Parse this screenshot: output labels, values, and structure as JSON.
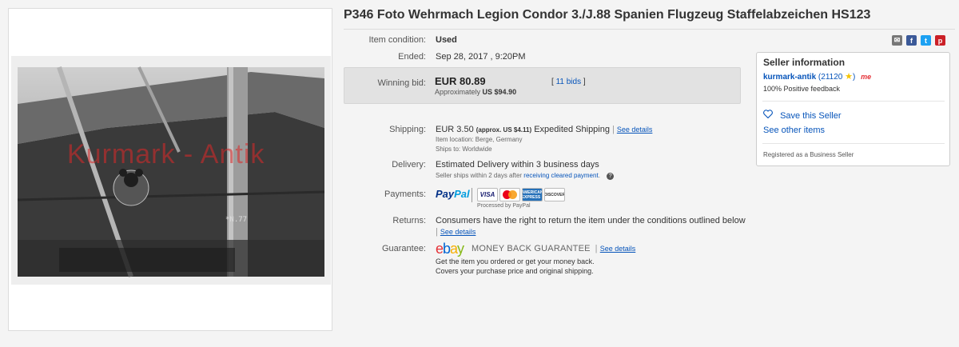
{
  "photo": {
    "watermark": "Kurmark - Antik",
    "plane_marking": "*N.77"
  },
  "title": "P346 Foto Wehrmach Legion Condor 3./J.88 Spanien Flugzeug Staffelabzeichen HS123",
  "share_icons": [
    "email-icon",
    "facebook-icon",
    "twitter-icon",
    "pinterest-icon"
  ],
  "condition": {
    "label": "Item condition:",
    "value": "Used"
  },
  "ended": {
    "label": "Ended:",
    "value": "Sep 28, 2017 , 9:20PM"
  },
  "bid": {
    "label": "Winning bid:",
    "amount": "EUR 80.89",
    "approx_prefix": "Approximately",
    "approx_value": "US $94.90",
    "bids_link": "11 bids",
    "bids_open": "[",
    "bids_close": "]"
  },
  "shipping": {
    "label": "Shipping:",
    "amount": "EUR 3.50",
    "approx": "(approx. US $4.11)",
    "method": "Expedited Shipping",
    "see_details": "See details",
    "item_location": "Item location:  Berge, Germany",
    "ships_to": "Ships to:  Worldwide"
  },
  "delivery": {
    "label": "Delivery:",
    "value": "Estimated Delivery within 3 business days",
    "note_prefix": "Seller ships within 2 days after",
    "note_link": "receiving cleared payment",
    "note_suffix": "."
  },
  "payments": {
    "label": "Payments:",
    "paypal_dark": "Pay",
    "paypal_light": "Pal",
    "cards": [
      "VISA",
      "",
      "AMERICAN EXPRESS",
      "DISCOVER"
    ],
    "processed": "Processed by PayPal"
  },
  "returns": {
    "label": "Returns:",
    "value": "Consumers have the right to return the item under the conditions outlined below",
    "see_details": "See details"
  },
  "guarantee": {
    "label": "Guarantee:",
    "ebay_e": "e",
    "ebay_b": "b",
    "ebay_a": "a",
    "ebay_y": "y",
    "mbg": "MONEY BACK GUARANTEE",
    "see_details": "See details",
    "line1": "Get the item you ordered or get your money back.",
    "line2": "Covers your purchase price and original shipping."
  },
  "seller": {
    "title": "Seller information",
    "username": "kurmark-antik",
    "score": "(21120",
    "feedback": "100% Positive feedback",
    "save": "Save this Seller",
    "other_items": "See other items",
    "business": "Registered as a Business Seller",
    "me_badge": "me"
  },
  "colors": {
    "link": "#0654ba",
    "bid_box": "#e2e2e2",
    "watermark": "#dc2828"
  }
}
